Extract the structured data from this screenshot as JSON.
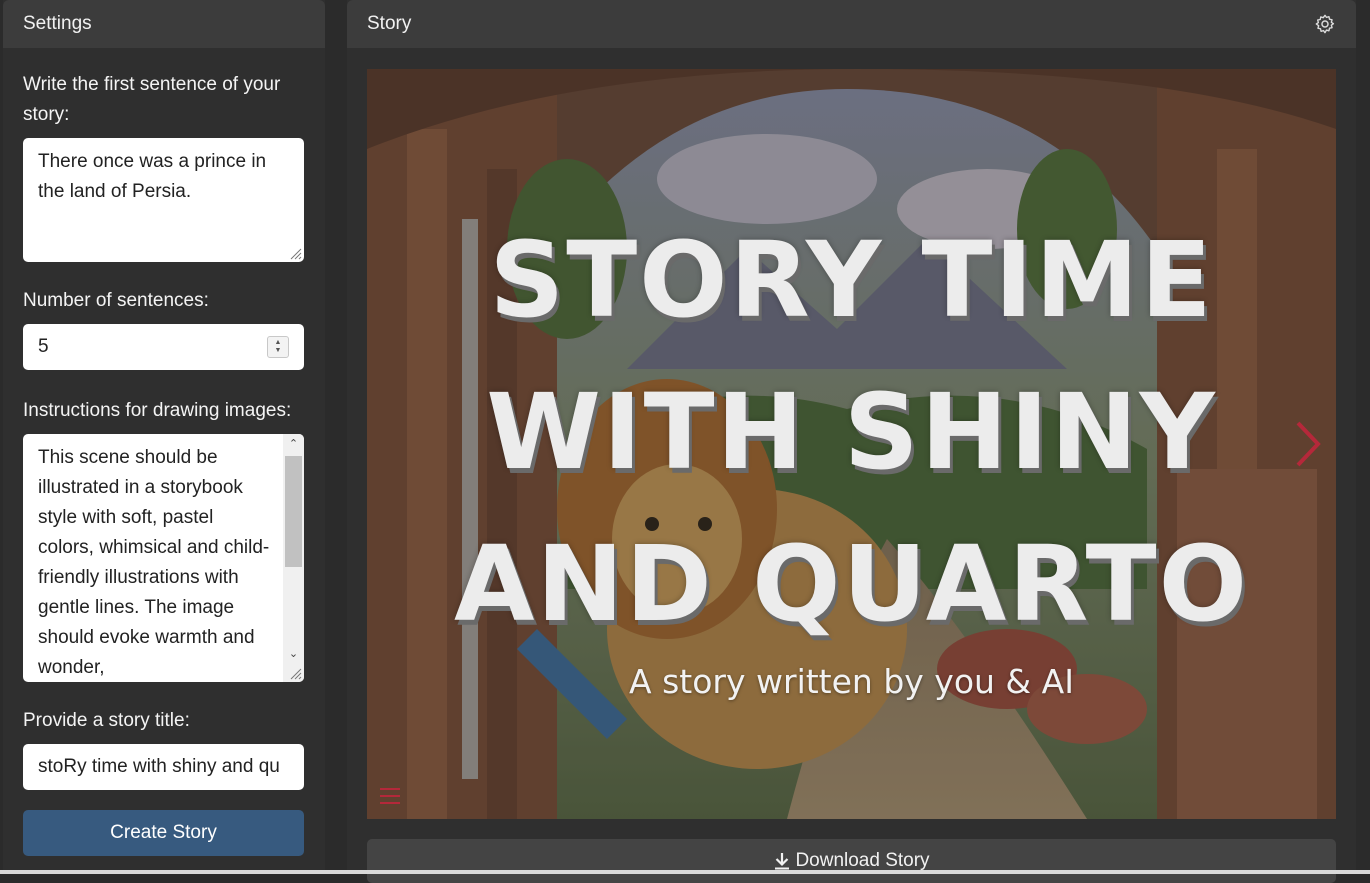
{
  "sidebar": {
    "title": "Settings",
    "first_sentence_label": "Write the first sentence of your story:",
    "first_sentence_value": "There once was a prince in the land of Persia.",
    "num_sentences_label": "Number of sentences:",
    "num_sentences_value": "5",
    "instructions_label": "Instructions for drawing images:",
    "instructions_value": "This scene should be illustrated in a storybook style with soft, pastel colors, whimsical and child-friendly illustrations with gentle lines. The image should evoke warmth and wonder,",
    "title_label": "Provide a story title:",
    "title_value": "stoRy time with shiny and qu",
    "create_button": "Create Story"
  },
  "main": {
    "title": "Story",
    "story_title_lines": [
      "STORY TIME",
      "WITH SHINY",
      "AND QUARTO"
    ],
    "subtitle": "A story written by you & AI",
    "download_button": "Download Story"
  },
  "colors": {
    "background": "#2b2b2b",
    "header": "#3c3c3c",
    "primary_button": "#375a7f",
    "accent_red": "#b5283a"
  },
  "icons": {
    "settings": "gear-icon",
    "next": "chevron-right-icon",
    "menu": "hamburger-menu-icon",
    "download": "download-icon"
  }
}
